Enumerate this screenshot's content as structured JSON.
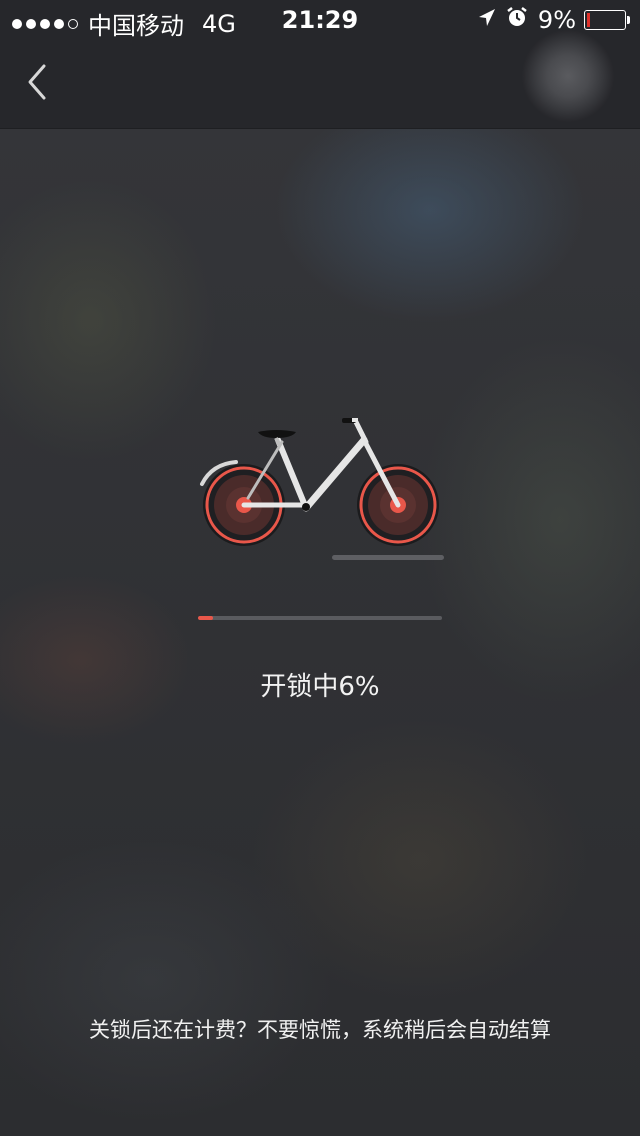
{
  "status_bar": {
    "carrier": "中国移动",
    "network": "4G",
    "time": "21:29",
    "battery_percent_label": "9%",
    "battery_level": 0.09,
    "icons": [
      "signal-dots-icon",
      "location-arrow-icon",
      "alarm-clock-icon",
      "battery-icon"
    ]
  },
  "nav": {
    "back_icon": "chevron-left-icon"
  },
  "unlock": {
    "status_label": "开锁中6%",
    "progress_percent": 6,
    "accent_color": "#e9574a"
  },
  "footer": {
    "tip": "关锁后还在计费？不要惊慌，系统稍后会自动结算"
  }
}
